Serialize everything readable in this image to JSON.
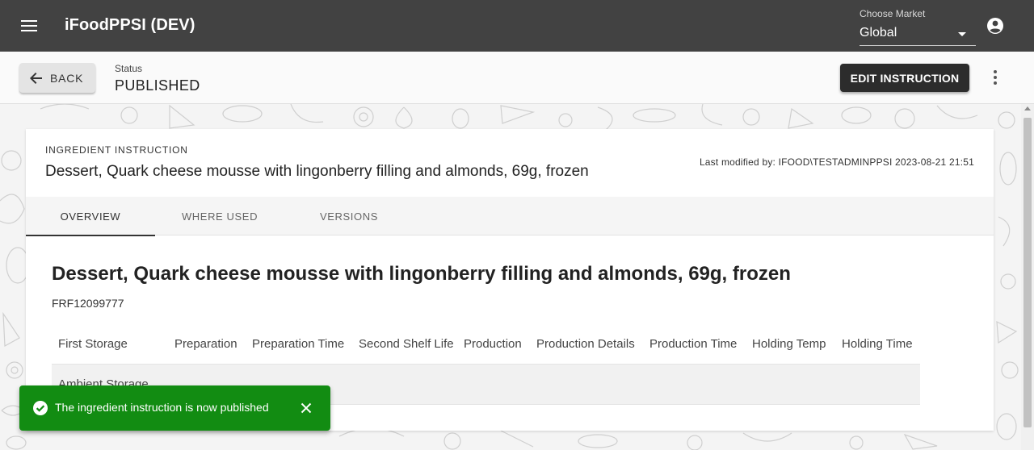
{
  "appbar": {
    "title": "iFoodPPSI (DEV)",
    "market_label": "Choose Market",
    "market_value": "Global"
  },
  "toolbar": {
    "back_label": "BACK",
    "status_label": "Status",
    "status_value": "PUBLISHED",
    "edit_label": "EDIT INSTRUCTION"
  },
  "card": {
    "kicker": "INGREDIENT INSTRUCTION",
    "subtitle": "Dessert, Quark cheese mousse with lingonberry filling and almonds, 69g, frozen",
    "last_modified": "Last modified by: IFOOD\\TESTADMINPPSI 2023-08-21 21:51",
    "tabs": [
      {
        "label": "OVERVIEW",
        "active": true
      },
      {
        "label": "WHERE USED",
        "active": false
      },
      {
        "label": "VERSIONS",
        "active": false
      }
    ],
    "product_title": "Dessert, Quark cheese mousse with lingonberry filling and almonds, 69g, frozen",
    "product_code": "FRF12099777",
    "table": {
      "columns": [
        "First Storage",
        "Preparation",
        "Preparation Time",
        "Second Shelf Life",
        "Production",
        "Production Details",
        "Production Time",
        "Holding Temp",
        "Holding Time"
      ],
      "rows": [
        [
          "Ambient Storage",
          "",
          "",
          "",
          "",
          "",
          "",
          "",
          ""
        ]
      ]
    }
  },
  "snackbar": {
    "message": "The ingredient instruction is now published",
    "color": "#128c12"
  },
  "icons": {
    "menu": "menu-icon",
    "account": "account-circle-icon",
    "back": "arrow-left-icon",
    "more": "more-vert-icon",
    "success": "check-circle-icon",
    "close": "close-icon"
  }
}
